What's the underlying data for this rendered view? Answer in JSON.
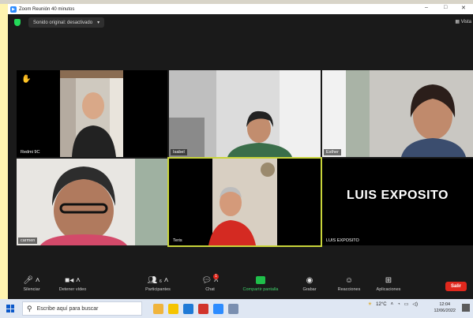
{
  "window": {
    "title": "Zoom Reunión 40 minutos"
  },
  "topbar": {
    "audio_label": "Sonido original: desactivado",
    "view_label": "Vista"
  },
  "participants": [
    {
      "name": "Redmi 9C",
      "hand_raised": true
    },
    {
      "name": "Isabel"
    },
    {
      "name": "Esther"
    },
    {
      "name": "carmen"
    },
    {
      "name": "Teris",
      "active_speaker": true
    },
    {
      "name": "LUIS EXPOSITO",
      "video_off_name": "LUIS EXPOSITO"
    }
  ],
  "toolbar": {
    "items": [
      {
        "label": "Silenciar",
        "icon": "microphone-icon"
      },
      {
        "label": "Detener vídeo",
        "icon": "video-camera-icon"
      },
      {
        "label": "Participantes",
        "icon": "participants-icon",
        "count": "6"
      },
      {
        "label": "Chat",
        "icon": "chat-icon",
        "badge": "1"
      },
      {
        "label": "Compartir pantalla",
        "icon": "share-screen-icon"
      },
      {
        "label": "Grabar",
        "icon": "record-icon"
      },
      {
        "label": "Reacciones",
        "icon": "reactions-icon"
      },
      {
        "label": "Aplicaciones",
        "icon": "apps-icon"
      }
    ],
    "leave_label": "Salir"
  },
  "taskbar": {
    "search_placeholder": "Escribe aquí para buscar",
    "weather": "12°C",
    "time": "12:04",
    "date": "12/06/2022"
  },
  "colors": {
    "speaker_outline": "#c8d43a",
    "leave_button": "#e0281d",
    "share_green": "#1fbf4a",
    "shield_green": "#23d959"
  }
}
